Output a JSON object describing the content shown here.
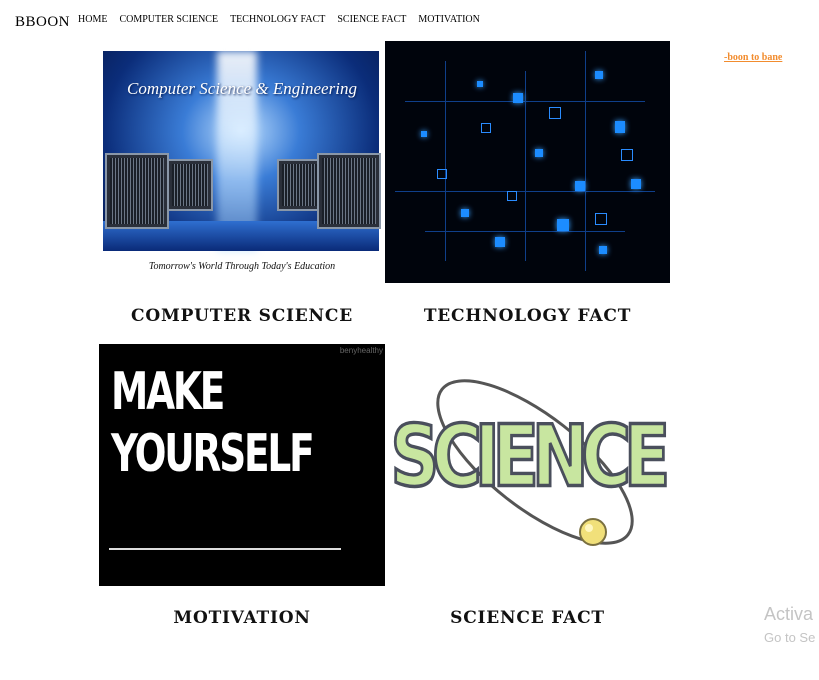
{
  "header": {
    "brand": "BBOON",
    "nav": [
      "HOME",
      "COMPUTER SCIENCE",
      "TECHNOLOGY FACT",
      "SCIENCE FACT",
      "MOTIVATION"
    ]
  },
  "side_link": "-boon to bane",
  "tiles": [
    {
      "caption": "COMPUTER SCIENCE",
      "image_title": "Computer Science & Engineering",
      "image_tagline": "Tomorrow's World Through Today's Education"
    },
    {
      "caption": "TECHNOLOGY FACT"
    },
    {
      "caption": "MOTIVATION",
      "image_line1": "MAKE",
      "image_line2": "YOURSELF",
      "image_watermark": "benyhealthy"
    },
    {
      "caption": "SCIENCE FACT",
      "image_word": "SCIENCE"
    }
  ],
  "watermark": {
    "line1": "Activa",
    "line2": "Go to Se"
  },
  "colors": {
    "side_link": "#f28c2e",
    "tech_accent": "#1c8cff"
  }
}
